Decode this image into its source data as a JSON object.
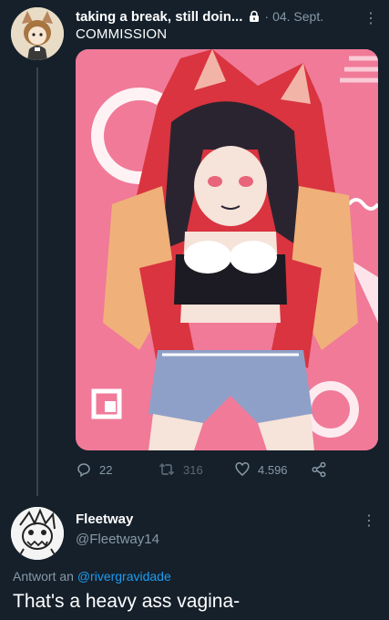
{
  "tweet1": {
    "display_name": "taking a break, still doin...",
    "date": "04. Sept.",
    "separator": "·",
    "text": "COMMISSION",
    "actions": {
      "replies": "22",
      "retweets": "316",
      "likes": "4.596"
    }
  },
  "tweet2": {
    "display_name": "Fleetway",
    "handle": "@Fleetway14",
    "reply_prefix": "Antwort an",
    "reply_mention": "@rivergravidade",
    "text": "That's a heavy ass vagina-"
  },
  "icons": {
    "more": "more-icon",
    "lock": "lock-icon",
    "reply": "reply-icon",
    "retweet": "retweet-icon",
    "like": "heart-icon",
    "share": "share-icon"
  },
  "colors": {
    "background": "#15202b",
    "secondary_text": "#8899a6",
    "link": "#1d9bf0",
    "image_background": "#f07a98"
  }
}
